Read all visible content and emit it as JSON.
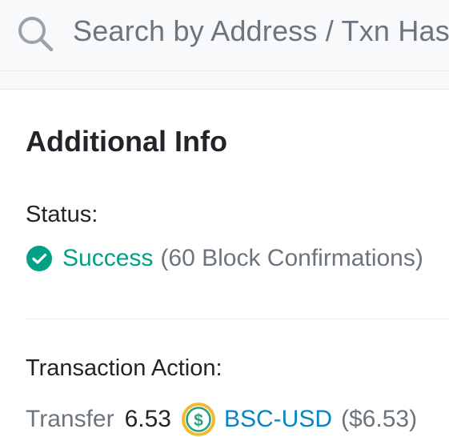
{
  "search": {
    "placeholder": "Search by Address / Txn Hash / Block / Token / Domain Name",
    "icon": "search-icon"
  },
  "card": {
    "title": "Additional Info",
    "status": {
      "label": "Status:",
      "value": "Success",
      "confirmations": "(60 Block Confirmations)",
      "icon": "check-circle-icon",
      "color": "#00a186"
    },
    "action": {
      "label": "Transaction Action:",
      "verb": "Transfer",
      "amount": "6.53",
      "token_icon": "dollar-coin-icon",
      "token": "BSC-USD",
      "usd_value": "($6.53)",
      "link_color": "#0784c3"
    }
  }
}
